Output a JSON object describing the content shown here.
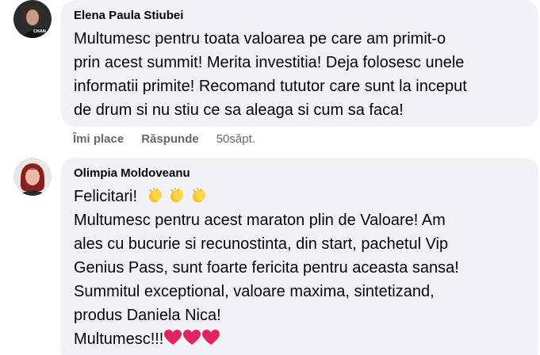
{
  "comments": [
    {
      "author": "Elena Paula Stiubei",
      "avatar_badge": "CHAN",
      "lines": [
        "Multumesc pentru toata valoarea pe care am primit-o",
        "prin acest summit! Merita investitia! Deja folosesc unele",
        "informatii primite! Recomand tututor care sunt la inceput",
        "de drum si nu stiu ce sa aleaga si cum sa faca!"
      ],
      "actions": {
        "like": "Îmi place",
        "reply": "Răspunde",
        "time": "50săpt."
      }
    },
    {
      "author": "Olimpia Moldoveanu",
      "line1": "Felicitari!",
      "line1_emoji": "clapping-hands",
      "lines": [
        "Multumesc pentru acest maraton plin de Valoare! Am",
        "ales cu bucurie si recunostinta, din start, pachetul Vip",
        "Genius Pass, sunt foarte fericita pentru aceasta sansa!",
        "Summitul exceptional, valoare maxima, sintetizand,",
        "produs Daniela Nica!"
      ],
      "last_line": "Multumesc!!!",
      "last_line_emoji": "red-heart",
      "emoji_count": 3
    }
  ],
  "colors": {
    "bubble": "#f0f2f5",
    "text": "#050505",
    "secondary": "#65676b",
    "heart": "#e0245e",
    "clap": "#f7c22b"
  }
}
